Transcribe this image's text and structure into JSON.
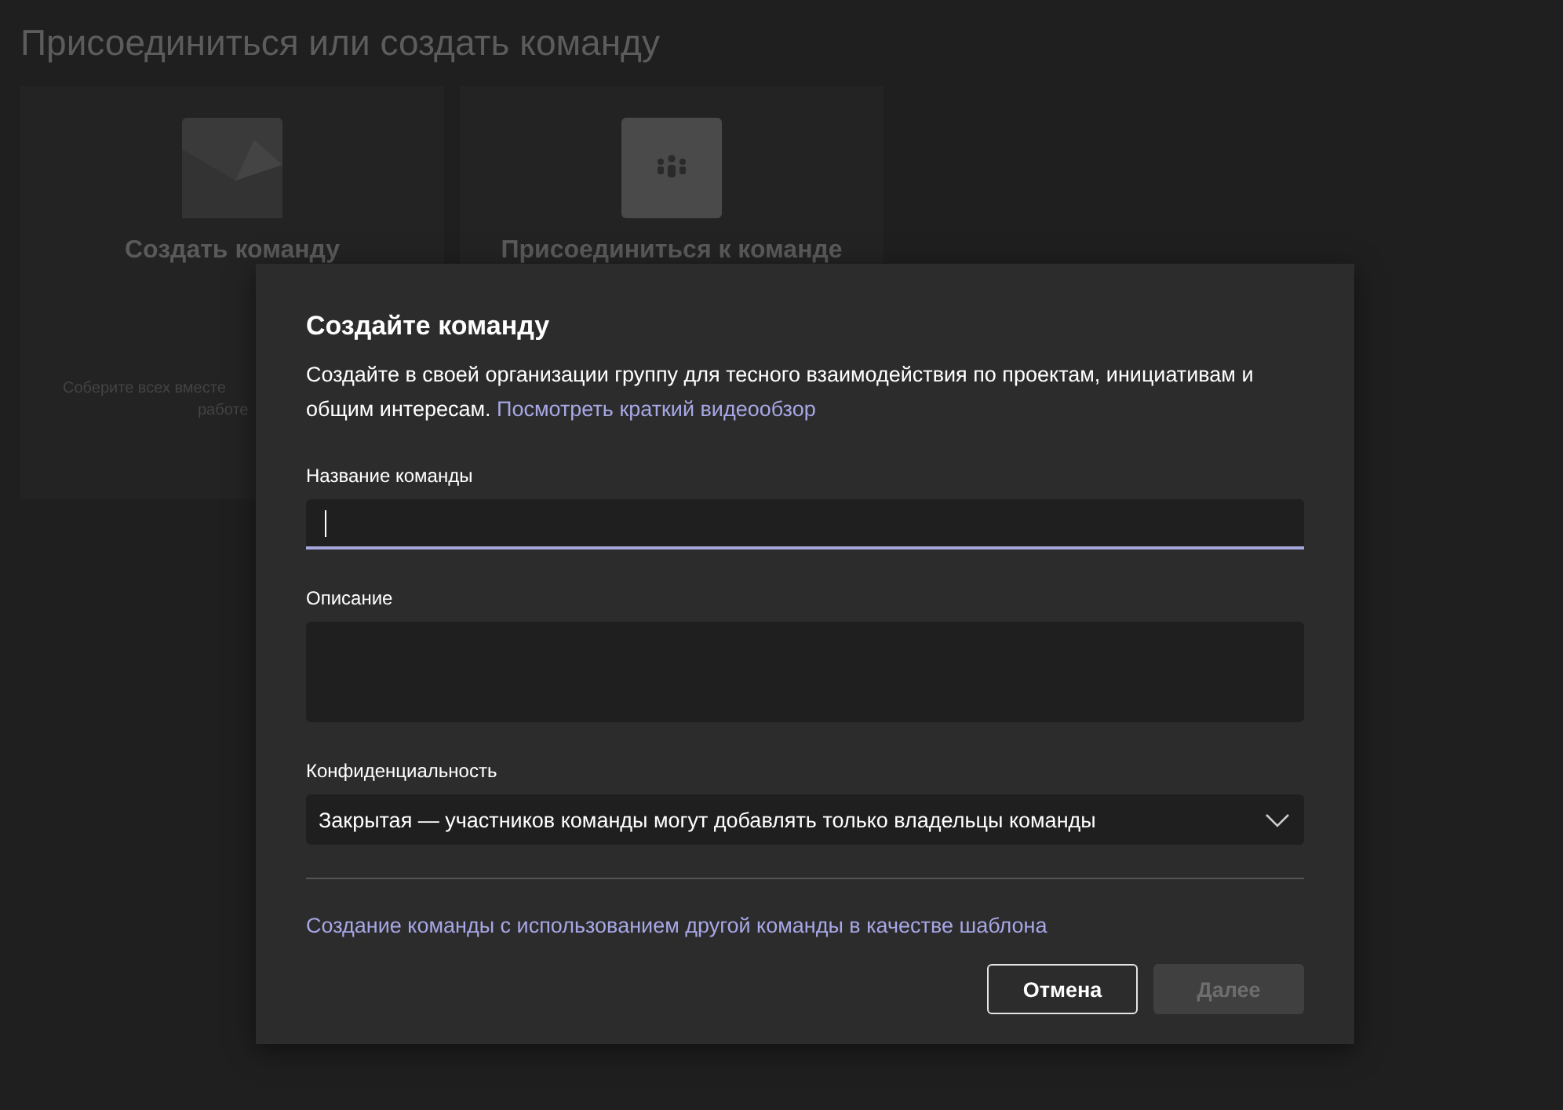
{
  "page": {
    "title": "Присоединиться или создать команду"
  },
  "cards": [
    {
      "kind": "create",
      "title": "Создать команду",
      "description_lines": [
        "Соберите всех вместе",
        "работе"
      ]
    },
    {
      "kind": "join",
      "title": "Присоединиться к команде"
    }
  ],
  "dialog": {
    "title": "Создайте команду",
    "description": "Создайте в своей организации группу для тесного взаимодействия по проектам, инициативам и общим интересам.",
    "video_link": "Посмотреть краткий видеообзор",
    "name_field": {
      "label": "Название команды",
      "focused": true
    },
    "description_field": {
      "label": "Описание"
    },
    "privacy": {
      "label": "Конфиденциальность",
      "value": "Закрытая — участников команды могут добавлять только владельцы команды"
    },
    "template_link": "Создание команды с использованием другой команды в качестве шаблона",
    "buttons": [
      {
        "label": "Отмена",
        "kind": "secondary",
        "disabled": false
      },
      {
        "label": "Далее",
        "kind": "primary",
        "disabled": true
      }
    ]
  }
}
